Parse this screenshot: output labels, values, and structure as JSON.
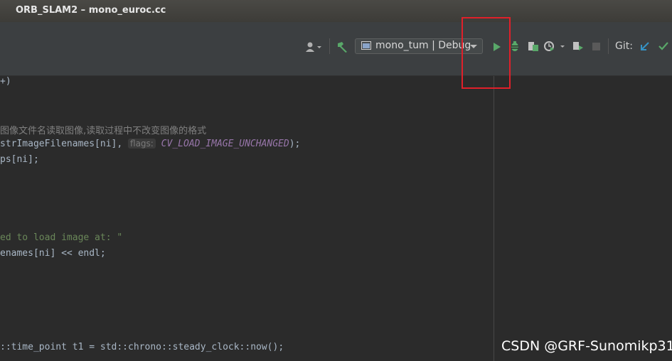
{
  "window": {
    "title": "ORB_SLAM2 – mono_euroc.cc"
  },
  "toolbar": {
    "run_config": {
      "label": "mono_tum | Debug",
      "icon": "run-config-icon"
    },
    "git_label": "Git:",
    "icons": [
      "user-icon",
      "build-hammer-icon",
      "run-icon",
      "debug-icon",
      "coverage-icon",
      "profile-icon",
      "attach-icon",
      "stop-icon",
      "vcs-update-icon",
      "vcs-commit-icon"
    ]
  },
  "editor": {
    "lines": {
      "l1": "+)",
      "l2_comment": "图像文件名读取图像,读取过程中不改变图像的格式",
      "l3_pre": "strImageFilenames[ni], ",
      "l3_hint": "flags:",
      "l3_const": "CV_LOAD_IMAGE_UNCHANGED",
      "l3_post": ");",
      "l4": "ps[ni];",
      "l5_str": "ed to load image at: \"",
      "l6_pre": "enames[ni] << endl;",
      "l7": "::time_point t1 = std::chrono::steady_clock::now();"
    }
  },
  "overlay": {
    "highlight_color": "#e0202a",
    "watermark": "CSDN @GRF-Sunomikp31"
  }
}
